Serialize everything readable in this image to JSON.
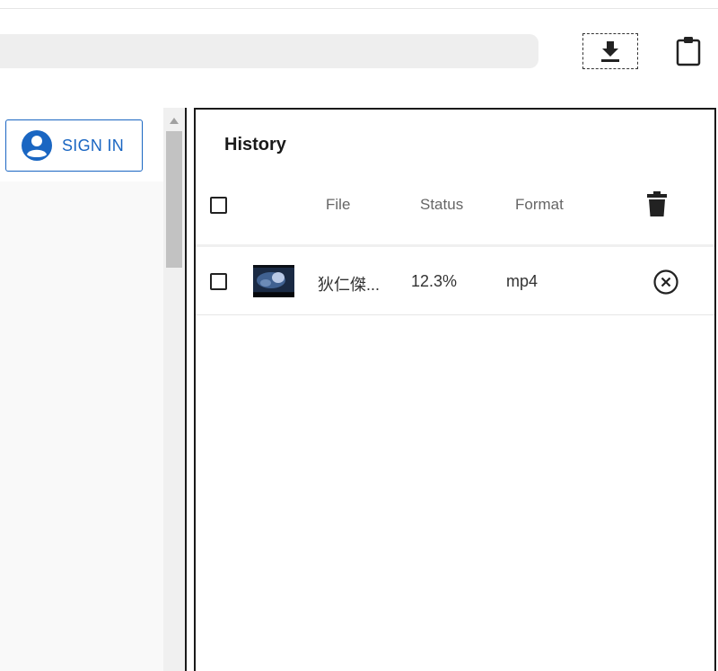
{
  "toolbar": {
    "url_value": "",
    "download_icon": "download-icon",
    "clipboard_icon": "clipboard-icon"
  },
  "left": {
    "sign_in_label": "SIGN IN",
    "account_icon": "account-circle-icon"
  },
  "history": {
    "title": "History",
    "columns": {
      "file": "File",
      "status": "Status",
      "format": "Format"
    },
    "delete_all_icon": "trash-icon",
    "rows": [
      {
        "file": "狄仁傑...",
        "status": "12.3%",
        "format": "mp4",
        "cancel_icon": "cancel-circle-icon"
      }
    ]
  },
  "colors": {
    "accent": "#1a66c2",
    "border": "#1a1a1a",
    "muted_text": "#666666"
  }
}
